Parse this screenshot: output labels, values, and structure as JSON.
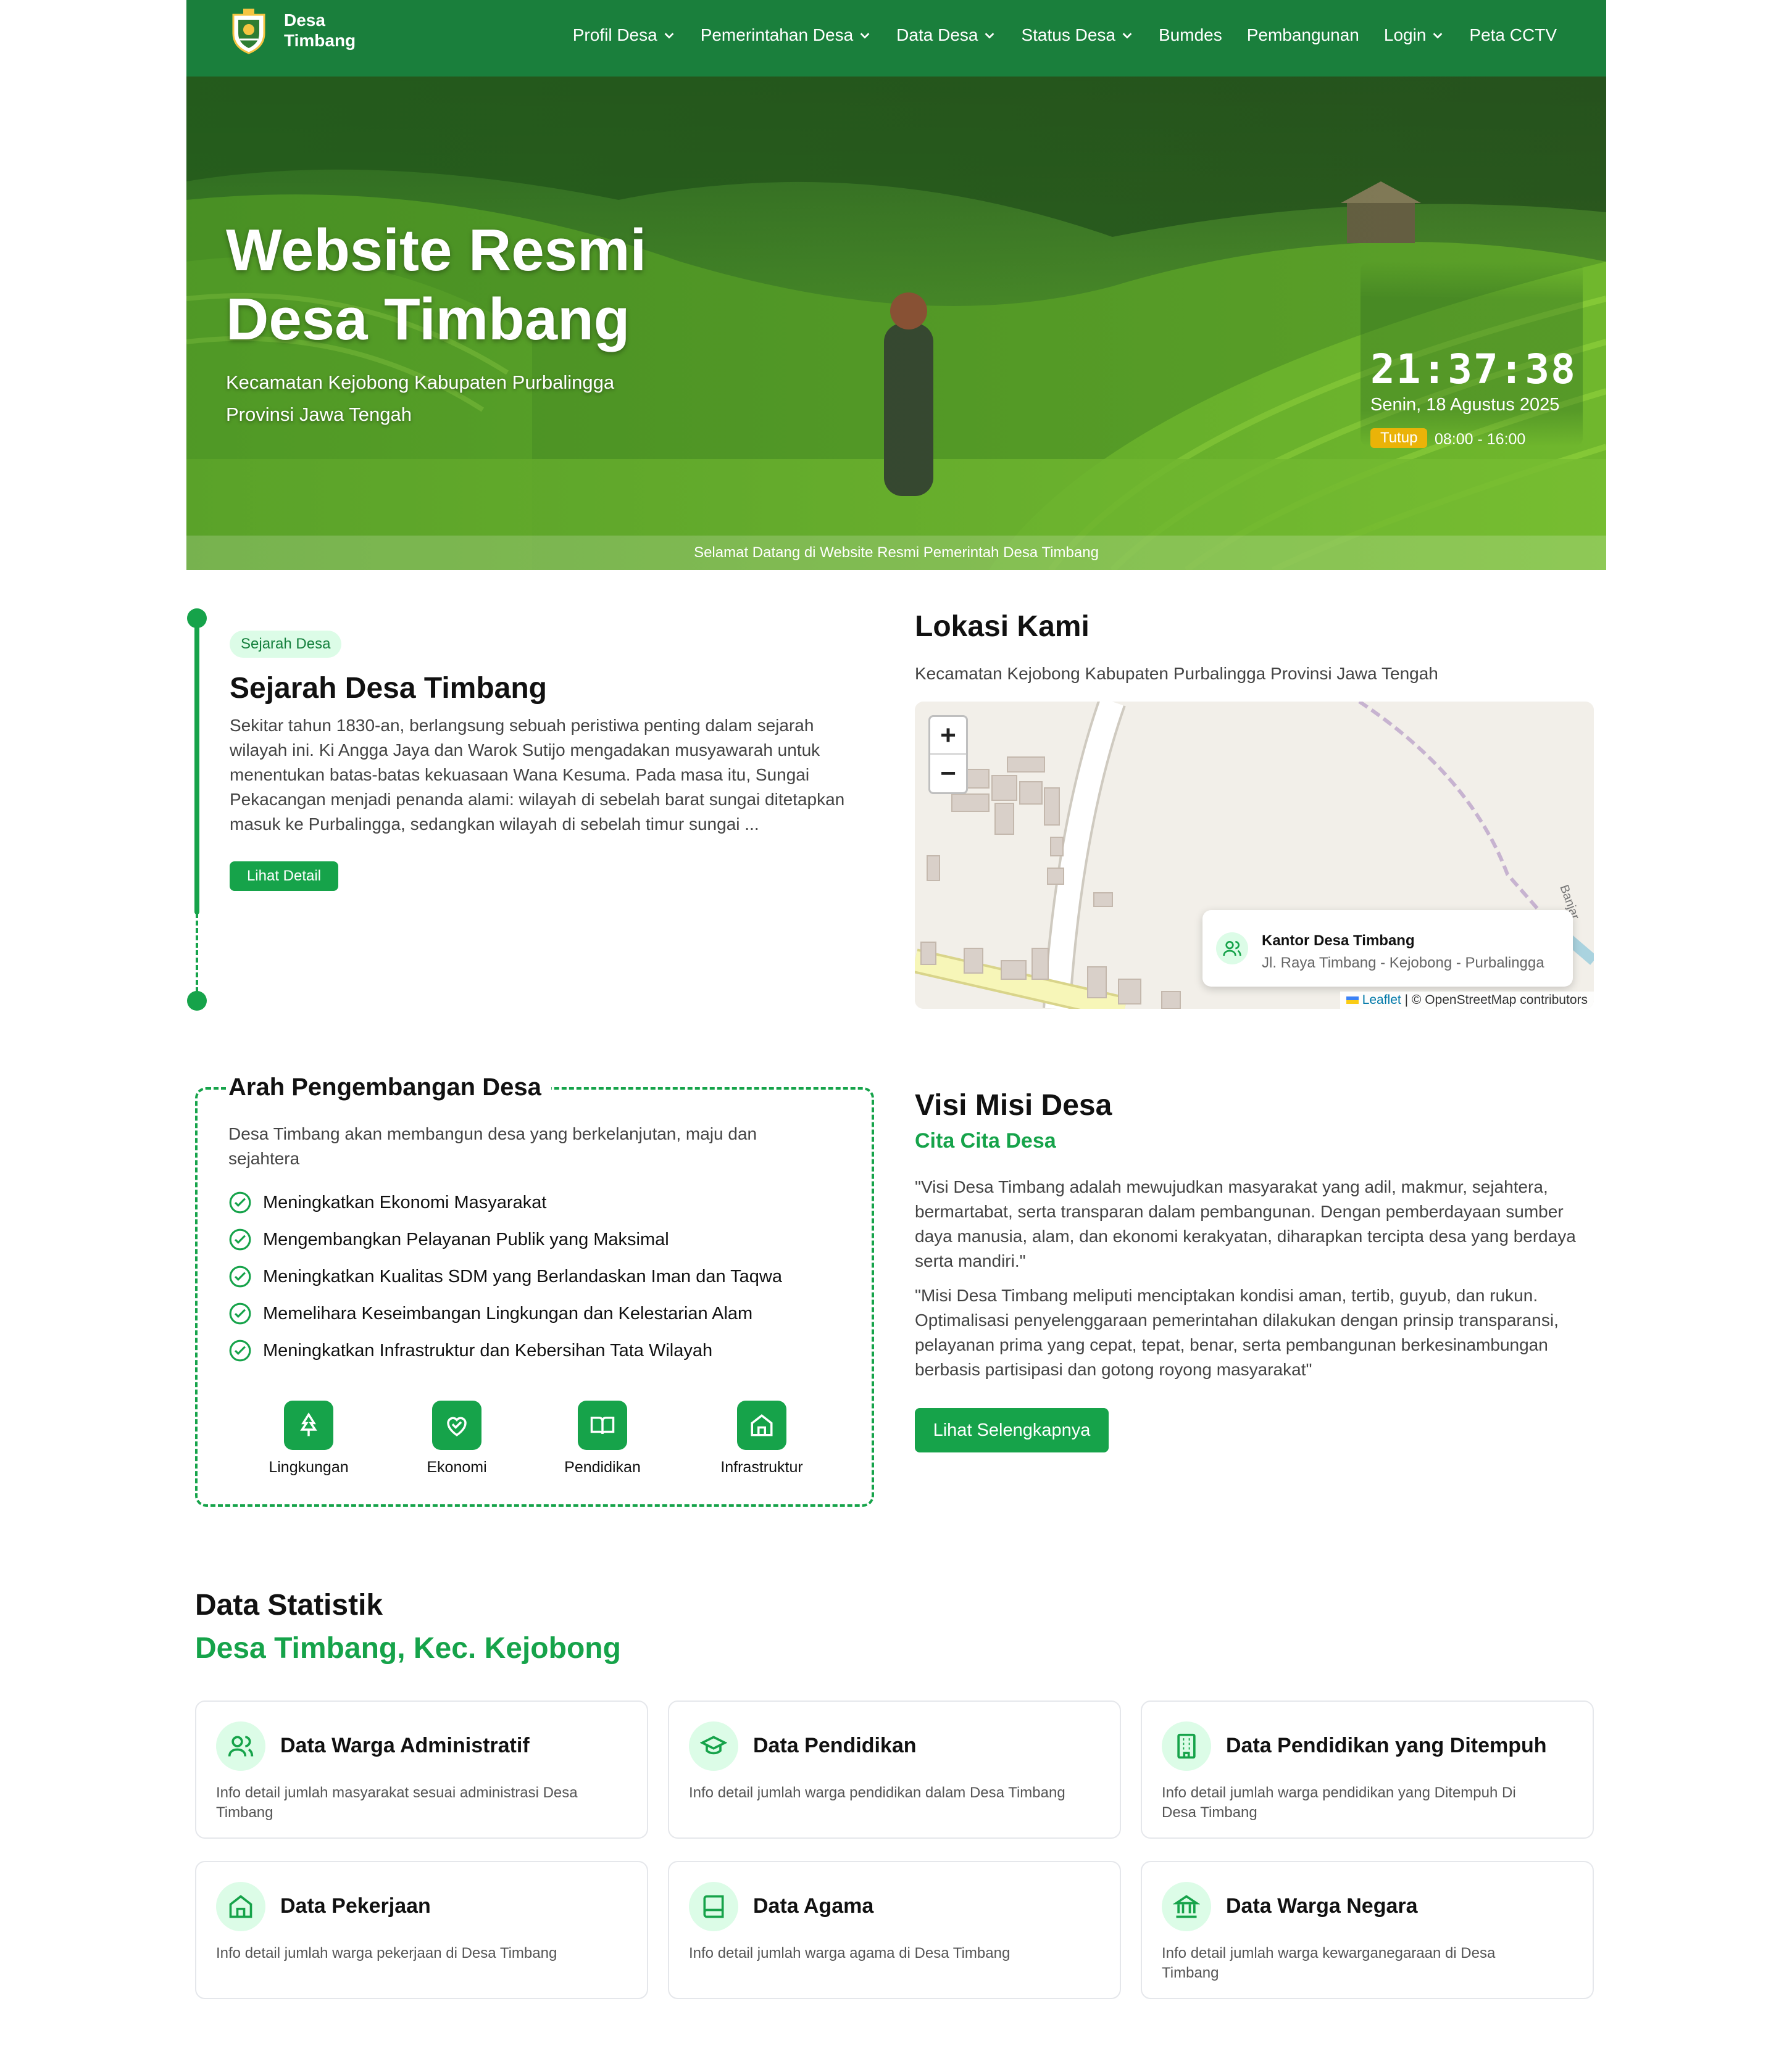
{
  "nav": {
    "brand_line1": "Desa",
    "brand_line2": "Timbang",
    "items": [
      {
        "label": "Profil Desa",
        "dropdown": true
      },
      {
        "label": "Pemerintahan Desa",
        "dropdown": true
      },
      {
        "label": "Data Desa",
        "dropdown": true
      },
      {
        "label": "Status Desa",
        "dropdown": true
      },
      {
        "label": "Bumdes",
        "dropdown": false
      },
      {
        "label": "Pembangunan",
        "dropdown": false
      },
      {
        "label": "Login",
        "dropdown": true
      },
      {
        "label": "Peta CCTV",
        "dropdown": false
      }
    ]
  },
  "hero": {
    "title_line1": "Website Resmi",
    "title_line2": "Desa Timbang",
    "subtitle_line1": "Kecamatan Kejobong Kabupaten Purbalingga",
    "subtitle_line2": "Provinsi Jawa Tengah",
    "clock_time": "21:37:38",
    "clock_date": "Senin, 18 Agustus 2025",
    "status_badge": "Tutup",
    "office_hours": "08:00 - 16:00",
    "welcome_text": "Selamat Datang di Website Resmi Pemerintah Desa Timbang"
  },
  "sejarah": {
    "tag": "Sejarah Desa",
    "title": "Sejarah Desa Timbang",
    "lines": [
      "Sekitar tahun 1830-an, berlangsung sebuah peristiwa penting dalam sejarah",
      "wilayah ini. Ki Angga Jaya dan Warok Sutijo mengadakan musyawarah untuk",
      "menentukan batas-batas kekuasaan Wana Kesuma. Pada masa itu, Sungai",
      "Pekacangan menjadi penanda alami: wilayah di sebelah barat sungai ditetapkan",
      "masuk ke Purbalingga, sedangkan wilayah di sebelah timur sungai ..."
    ],
    "button": "Lihat Detail"
  },
  "lokasi": {
    "title": "Lokasi Kami",
    "subtitle": "Kecamatan Kejobong Kabupaten Purbalingga Provinsi Jawa Tengah",
    "zoom_in": "+",
    "zoom_out": "−",
    "popup_title": "Kantor Desa Timbang",
    "popup_address": "Jl. Raya Timbang - Kejobong - Purbalingga",
    "road_label": "Banjar",
    "attribution_link": "Leaflet",
    "attribution_text": "| © OpenStreetMap contributors"
  },
  "arah": {
    "title": "Arah Pengembangan Desa",
    "desc_line1": "Desa Timbang akan membangun desa yang berkelanjutan, maju dan",
    "desc_line2": "sejahtera",
    "goals": [
      "Meningkatkan Ekonomi Masyarakat",
      "Mengembangkan Pelayanan Publik yang Maksimal",
      "Meningkatkan Kualitas SDM yang Berlandaskan Iman dan Taqwa",
      "Memelihara Keseimbangan Lingkungan dan Kelestarian Alam",
      "Meningkatkan Infrastruktur dan Kebersihan Tata Wilayah"
    ],
    "categories": [
      {
        "label": "Lingkungan",
        "icon": "tree-icon"
      },
      {
        "label": "Ekonomi",
        "icon": "handshake-heart-icon"
      },
      {
        "label": "Pendidikan",
        "icon": "book-open-icon"
      },
      {
        "label": "Infrastruktur",
        "icon": "home-icon"
      }
    ]
  },
  "visi": {
    "title": "Visi Misi Desa",
    "subtitle": "Cita Cita Desa",
    "visi_lines": [
      "\"Visi Desa Timbang adalah mewujudkan masyarakat yang adil, makmur, sejahtera,",
      "bermartabat, serta transparan dalam pembangunan. Dengan pemberdayaan sumber",
      "daya manusia, alam, dan ekonomi kerakyatan, diharapkan tercipta desa yang berdaya",
      "serta mandiri.\""
    ],
    "misi_lines": [
      "\"Misi Desa Timbang meliputi menciptakan kondisi aman, tertib, guyub, dan rukun.",
      "Optimalisasi penyelenggaraan pemerintahan dilakukan dengan prinsip transparansi,",
      "pelayanan prima yang cepat, tepat, benar, serta pembangunan berkesinambungan",
      "berbasis partisipasi dan gotong royong masyarakat\""
    ],
    "button": "Lihat Selengkapnya"
  },
  "statistik": {
    "title": "Data Statistik",
    "subtitle": "Desa Timbang, Kec. Kejobong",
    "cards": [
      {
        "title": "Data Warga Administratif",
        "desc_line1": "Info detail jumlah masyarakat sesuai administrasi Desa",
        "desc_line2": "Timbang",
        "icon": "users-icon"
      },
      {
        "title": "Data Pendidikan",
        "desc_line1": "Info detail jumlah warga pendidikan dalam Desa Timbang",
        "desc_line2": "",
        "icon": "graduation-cap-icon"
      },
      {
        "title": "Data Pendidikan yang Ditempuh",
        "desc_line1": "Info detail jumlah warga pendidikan yang Ditempuh Di",
        "desc_line2": "Desa Timbang",
        "icon": "building-icon"
      },
      {
        "title": "Data Pekerjaan",
        "desc_line1": "Info detail jumlah warga pekerjaan di Desa Timbang",
        "desc_line2": "",
        "icon": "home-icon"
      },
      {
        "title": "Data Agama",
        "desc_line1": "Info detail jumlah warga agama di Desa Timbang",
        "desc_line2": "",
        "icon": "book-icon"
      },
      {
        "title": "Data Warga Negara",
        "desc_line1": "Info detail jumlah warga kewarganegaraan di Desa",
        "desc_line2": "Timbang",
        "icon": "landmark-icon"
      }
    ]
  },
  "colors": {
    "primary": "#16a34a",
    "nav": "#1a7f3c",
    "badge": "#eab308",
    "tint": "#dcfce7"
  }
}
